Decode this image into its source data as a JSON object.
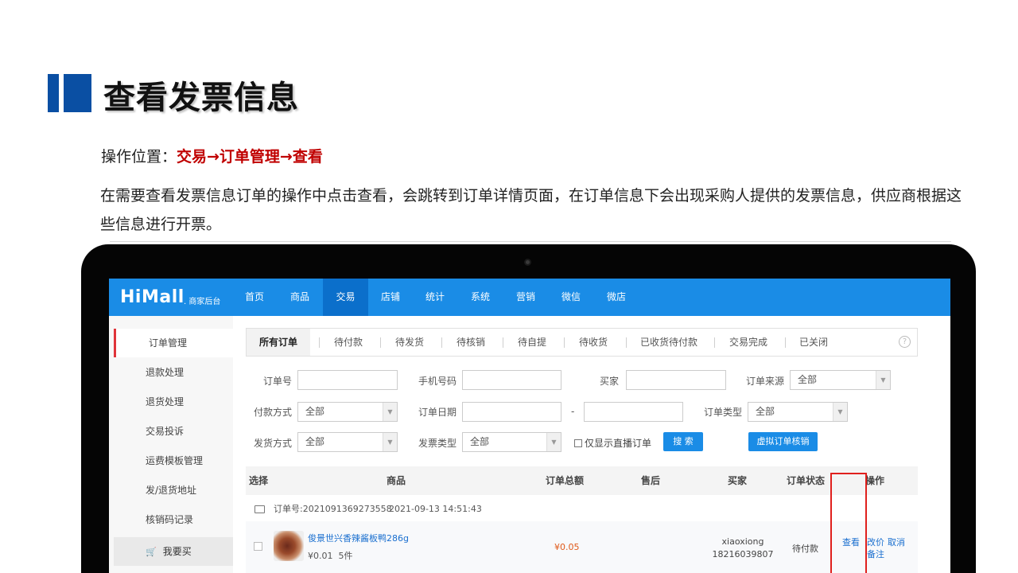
{
  "slide": {
    "title": "查看发票信息",
    "op_label": "操作位置：",
    "op_path": "交易→订单管理→查看",
    "description": "在需要查看发票信息订单的操作中点击查看，会跳转到订单详情页面，在订单信息下会出现采购人提供的发票信息，供应商根据这些信息进行开票。"
  },
  "app": {
    "logo": "HiMall",
    "logo_sub": ". 商家后台",
    "nav": [
      "首页",
      "商品",
      "交易",
      "店铺",
      "统计",
      "系统",
      "营销",
      "微信",
      "微店"
    ],
    "active_nav": "交易",
    "sidebar": [
      "订单管理",
      "退款处理",
      "退货处理",
      "交易投诉",
      "运费模板管理",
      "发/退货地址",
      "核销码记录"
    ],
    "sidebar_bottom": "我要买",
    "tabs": [
      "所有订单",
      "待付款",
      "待发货",
      "待核销",
      "待自提",
      "待收货",
      "已收货待付款",
      "交易完成",
      "已关闭"
    ],
    "help": "?",
    "filters": {
      "order_no": "订单号",
      "phone": "手机号码",
      "buyer": "买家",
      "order_source": "订单来源",
      "order_source_value": "全部",
      "pay_method": "付款方式",
      "pay_method_value": "全部",
      "order_date": "订单日期",
      "date_sep": "-",
      "order_type": "订单类型",
      "order_type_value": "全部",
      "ship_method": "发货方式",
      "ship_method_value": "全部",
      "invoice_type": "发票类型",
      "invoice_type_value": "全部",
      "live_only": "仅显示直播订单",
      "search_btn": "搜 索",
      "virtual_btn": "虚拟订单核销"
    },
    "table": {
      "headers": [
        "选择",
        "商品",
        "订单总额",
        "售后",
        "买家",
        "订单状态",
        "操作"
      ],
      "order_no": "订单号:2021091369273558",
      "order_time": "2021-09-13 14:51:43",
      "product_name": "俊景世兴香辣酱板鸭286g",
      "product_price": "¥0.01",
      "product_qty": "5件",
      "total": "¥0.05",
      "buyer_name": "xiaoxiong",
      "buyer_phone": "18216039807",
      "status": "待付款",
      "actions": {
        "view": "查看",
        "change_price": "改价",
        "cancel": "取消",
        "remark": "备注"
      }
    }
  }
}
